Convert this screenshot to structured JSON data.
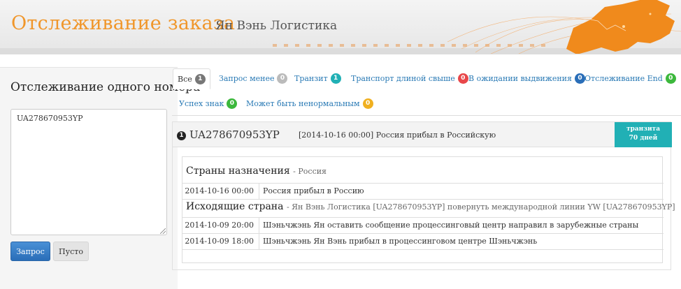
{
  "header": {
    "title": "Отслеживание заказа",
    "subtitle": "Ян Вэнь Логистика"
  },
  "sidebar": {
    "heading": "Отслеживание одного номера",
    "input_value": "UA278670953YP",
    "query_button": "Запрос",
    "clear_button": "Пусто"
  },
  "tabs": [
    {
      "label": "Все",
      "count": "1",
      "color": "#777777"
    },
    {
      "label": "Запрос менее",
      "count": "0",
      "color": "#bbbbbb"
    },
    {
      "label": "Транзит",
      "count": "1",
      "color": "#21b0b5"
    },
    {
      "label": "Транспорт длиной свыше",
      "count": "0",
      "color": "#e8474a"
    },
    {
      "label": "В ожидании выдвижения",
      "count": "0",
      "color": "#2a6eb8"
    },
    {
      "label": "Отслеживание End",
      "count": "0",
      "color": "#3cb83c"
    },
    {
      "label": "Успех знак",
      "count": "0",
      "color": "#3cb83c"
    },
    {
      "label": "Может быть ненормальным",
      "count": "0",
      "color": "#f0b020"
    }
  ],
  "result": {
    "index": "1",
    "tracking_number": "UA278670953YP",
    "last_event": "[2014-10-16 00:00] Россия прибыл в Российскую",
    "status_line1": "транзита",
    "status_line2": "70 дней",
    "status_color": "#21b0b5"
  },
  "destination": {
    "label": "Страны назначения",
    "country": "- Россия",
    "events": [
      {
        "date": "2014-10-16 00:00",
        "text": "Россия прибыл в Россию"
      }
    ]
  },
  "origin": {
    "label": "Исходящие страна",
    "detail": "- Ян Вэнь Логистика [UA278670953YP] повернуть международной линии YW [UA278670953YP]",
    "events": [
      {
        "date": "2014-10-09 20:00",
        "text": "Шэньчжэнь Ян оставить сообщение процессинговый центр направил в зарубежные страны"
      },
      {
        "date": "2014-10-09 18:00",
        "text": "Шэньчжэнь Ян Вэнь прибыл в процессинговом центре Шэньчжэнь"
      }
    ]
  }
}
